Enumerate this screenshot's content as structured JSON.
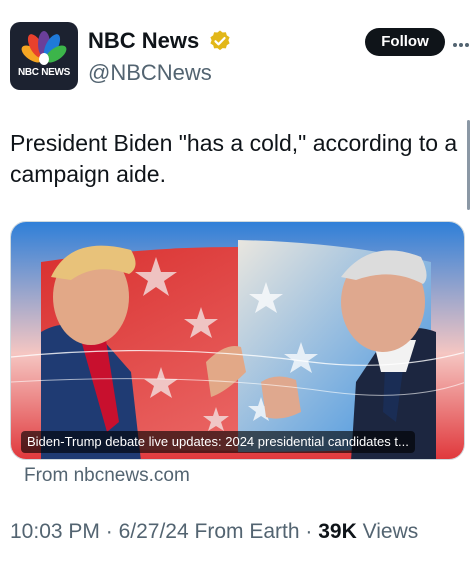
{
  "account": {
    "display_name": "NBC News",
    "handle": "@NBCNews",
    "avatar_text": "NBC NEWS",
    "verified_color": "#e2b719"
  },
  "actions": {
    "follow_label": "Follow",
    "more_icon": "more-horizontal-icon"
  },
  "tweet": {
    "text": "President Biden \"has a cold,\" according to a campaign aide."
  },
  "media": {
    "caption": "Biden-Trump debate live updates: 2024 presidential candidates t...",
    "source": "From nbcnews.com"
  },
  "meta": {
    "time": "10:03 PM",
    "separator": "·",
    "date": "6/27/24",
    "location": "From Earth",
    "views_count": "39K",
    "views_label": "Views"
  },
  "colors": {
    "text_primary": "#0f1419",
    "text_secondary": "#536471",
    "follow_bg": "#0f1419",
    "flag_red": "#e0363a",
    "flag_blue": "#2f7fd8"
  }
}
